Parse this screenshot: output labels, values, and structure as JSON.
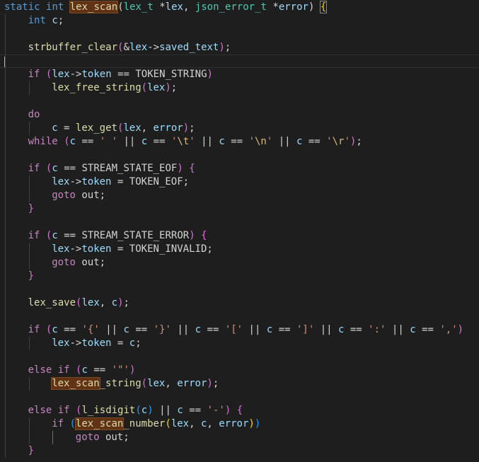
{
  "editor": {
    "language": "c",
    "highlighted_symbol": "lex_scan",
    "colors": {
      "background": "#1e1e1e",
      "keyword": "#569cd6",
      "control": "#c586c0",
      "type": "#4ec9b0",
      "function": "#dcdcaa",
      "variable": "#9cdcfe",
      "string": "#ce9178",
      "escape": "#d7ba7d",
      "selection_highlight": "#613214"
    },
    "lines": [
      {
        "indent": 0,
        "tokens": [
          [
            "kw",
            "static"
          ],
          [
            "op",
            " "
          ],
          [
            "kw",
            "int"
          ],
          [
            "op",
            " "
          ],
          [
            "fn hl",
            "lex_scan"
          ],
          [
            "op",
            "("
          ],
          [
            "ty",
            "lex_t"
          ],
          [
            "op",
            " *"
          ],
          [
            "var",
            "lex"
          ],
          [
            "op",
            ", "
          ],
          [
            "ty",
            "json_error_t"
          ],
          [
            "op",
            " *"
          ],
          [
            "var",
            "error"
          ],
          [
            "op",
            ") "
          ],
          [
            "br1 bm",
            "{"
          ]
        ]
      },
      {
        "indent": 1,
        "tokens": [
          [
            "kw",
            "int"
          ],
          [
            "op",
            " "
          ],
          [
            "var",
            "c"
          ],
          [
            "op",
            ";"
          ]
        ]
      },
      {
        "indent": 0,
        "tokens": []
      },
      {
        "indent": 1,
        "tokens": [
          [
            "fn",
            "strbuffer_clear"
          ],
          [
            "br2",
            "("
          ],
          [
            "op",
            "&"
          ],
          [
            "var",
            "lex"
          ],
          [
            "op",
            "->"
          ],
          [
            "var",
            "saved_text"
          ],
          [
            "br2",
            ")"
          ],
          [
            "op",
            ";"
          ]
        ]
      },
      {
        "indent": 0,
        "tokens": [],
        "current": true
      },
      {
        "indent": 1,
        "tokens": [
          [
            "ctl",
            "if"
          ],
          [
            "op",
            " "
          ],
          [
            "br2",
            "("
          ],
          [
            "var",
            "lex"
          ],
          [
            "op",
            "->"
          ],
          [
            "var",
            "token"
          ],
          [
            "op",
            " == "
          ],
          [
            "op",
            "TOKEN_STRING"
          ],
          [
            "br2",
            ")"
          ]
        ]
      },
      {
        "indent": 2,
        "tokens": [
          [
            "fn",
            "lex_free_string"
          ],
          [
            "br2",
            "("
          ],
          [
            "var",
            "lex"
          ],
          [
            "br2",
            ")"
          ],
          [
            "op",
            ";"
          ]
        ]
      },
      {
        "indent": 0,
        "tokens": []
      },
      {
        "indent": 1,
        "tokens": [
          [
            "ctl",
            "do"
          ]
        ]
      },
      {
        "indent": 2,
        "tokens": [
          [
            "var",
            "c"
          ],
          [
            "op",
            " = "
          ],
          [
            "fn",
            "lex_get"
          ],
          [
            "br2",
            "("
          ],
          [
            "var",
            "lex"
          ],
          [
            "op",
            ", "
          ],
          [
            "var",
            "error"
          ],
          [
            "br2",
            ")"
          ],
          [
            "op",
            ";"
          ]
        ]
      },
      {
        "indent": 1,
        "tokens": [
          [
            "ctl",
            "while"
          ],
          [
            "op",
            " "
          ],
          [
            "br2",
            "("
          ],
          [
            "var",
            "c"
          ],
          [
            "op",
            " == "
          ],
          [
            "str",
            "' '"
          ],
          [
            "op",
            " || "
          ],
          [
            "var",
            "c"
          ],
          [
            "op",
            " == "
          ],
          [
            "str",
            "'"
          ],
          [
            "esc",
            "\\t"
          ],
          [
            "str",
            "'"
          ],
          [
            "op",
            " || "
          ],
          [
            "var",
            "c"
          ],
          [
            "op",
            " == "
          ],
          [
            "str",
            "'"
          ],
          [
            "esc",
            "\\n"
          ],
          [
            "str",
            "'"
          ],
          [
            "op",
            " || "
          ],
          [
            "var",
            "c"
          ],
          [
            "op",
            " == "
          ],
          [
            "str",
            "'"
          ],
          [
            "esc",
            "\\r"
          ],
          [
            "str",
            "'"
          ],
          [
            "br2",
            ")"
          ],
          [
            "op",
            ";"
          ]
        ]
      },
      {
        "indent": 0,
        "tokens": []
      },
      {
        "indent": 1,
        "tokens": [
          [
            "ctl",
            "if"
          ],
          [
            "op",
            " "
          ],
          [
            "br2",
            "("
          ],
          [
            "var",
            "c"
          ],
          [
            "op",
            " == "
          ],
          [
            "op",
            "STREAM_STATE_EOF"
          ],
          [
            "br2",
            ")"
          ],
          [
            "op",
            " "
          ],
          [
            "br2",
            "{"
          ]
        ]
      },
      {
        "indent": 2,
        "tokens": [
          [
            "var",
            "lex"
          ],
          [
            "op",
            "->"
          ],
          [
            "var",
            "token"
          ],
          [
            "op",
            " = "
          ],
          [
            "op",
            "TOKEN_EOF"
          ],
          [
            "op",
            ";"
          ]
        ]
      },
      {
        "indent": 2,
        "tokens": [
          [
            "ctl",
            "goto"
          ],
          [
            "op",
            " out;"
          ]
        ]
      },
      {
        "indent": 1,
        "tokens": [
          [
            "br2",
            "}"
          ]
        ]
      },
      {
        "indent": 0,
        "tokens": []
      },
      {
        "indent": 1,
        "tokens": [
          [
            "ctl",
            "if"
          ],
          [
            "op",
            " "
          ],
          [
            "br2",
            "("
          ],
          [
            "var",
            "c"
          ],
          [
            "op",
            " == "
          ],
          [
            "op",
            "STREAM_STATE_ERROR"
          ],
          [
            "br2",
            ")"
          ],
          [
            "op",
            " "
          ],
          [
            "br2",
            "{"
          ]
        ]
      },
      {
        "indent": 2,
        "tokens": [
          [
            "var",
            "lex"
          ],
          [
            "op",
            "->"
          ],
          [
            "var",
            "token"
          ],
          [
            "op",
            " = "
          ],
          [
            "op",
            "TOKEN_INVALID"
          ],
          [
            "op",
            ";"
          ]
        ]
      },
      {
        "indent": 2,
        "tokens": [
          [
            "ctl",
            "goto"
          ],
          [
            "op",
            " out;"
          ]
        ]
      },
      {
        "indent": 1,
        "tokens": [
          [
            "br2",
            "}"
          ]
        ]
      },
      {
        "indent": 0,
        "tokens": []
      },
      {
        "indent": 1,
        "tokens": [
          [
            "fn",
            "lex_save"
          ],
          [
            "br2",
            "("
          ],
          [
            "var",
            "lex"
          ],
          [
            "op",
            ", "
          ],
          [
            "var",
            "c"
          ],
          [
            "br2",
            ")"
          ],
          [
            "op",
            ";"
          ]
        ]
      },
      {
        "indent": 0,
        "tokens": []
      },
      {
        "indent": 1,
        "tokens": [
          [
            "ctl",
            "if"
          ],
          [
            "op",
            " "
          ],
          [
            "br2",
            "("
          ],
          [
            "var",
            "c"
          ],
          [
            "op",
            " == "
          ],
          [
            "str",
            "'{'"
          ],
          [
            "op",
            " || "
          ],
          [
            "var",
            "c"
          ],
          [
            "op",
            " == "
          ],
          [
            "str",
            "'}'"
          ],
          [
            "op",
            " || "
          ],
          [
            "var",
            "c"
          ],
          [
            "op",
            " == "
          ],
          [
            "str",
            "'['"
          ],
          [
            "op",
            " || "
          ],
          [
            "var",
            "c"
          ],
          [
            "op",
            " == "
          ],
          [
            "str",
            "']'"
          ],
          [
            "op",
            " || "
          ],
          [
            "var",
            "c"
          ],
          [
            "op",
            " == "
          ],
          [
            "str",
            "':'"
          ],
          [
            "op",
            " || "
          ],
          [
            "var",
            "c"
          ],
          [
            "op",
            " == "
          ],
          [
            "str",
            "','"
          ],
          [
            "br2",
            ")"
          ]
        ]
      },
      {
        "indent": 2,
        "tokens": [
          [
            "var",
            "lex"
          ],
          [
            "op",
            "->"
          ],
          [
            "var",
            "token"
          ],
          [
            "op",
            " = "
          ],
          [
            "var",
            "c"
          ],
          [
            "op",
            ";"
          ]
        ]
      },
      {
        "indent": 0,
        "tokens": []
      },
      {
        "indent": 1,
        "tokens": [
          [
            "ctl",
            "else"
          ],
          [
            "op",
            " "
          ],
          [
            "ctl",
            "if"
          ],
          [
            "op",
            " "
          ],
          [
            "br2",
            "("
          ],
          [
            "var",
            "c"
          ],
          [
            "op",
            " == "
          ],
          [
            "str",
            "'\"'"
          ],
          [
            "br2",
            ")"
          ]
        ]
      },
      {
        "indent": 2,
        "tokens": [
          [
            "fn hl",
            "lex_scan"
          ],
          [
            "fn",
            "_string"
          ],
          [
            "br2",
            "("
          ],
          [
            "var",
            "lex"
          ],
          [
            "op",
            ", "
          ],
          [
            "var",
            "error"
          ],
          [
            "br2",
            ")"
          ],
          [
            "op",
            ";"
          ]
        ]
      },
      {
        "indent": 0,
        "tokens": []
      },
      {
        "indent": 1,
        "tokens": [
          [
            "ctl",
            "else"
          ],
          [
            "op",
            " "
          ],
          [
            "ctl",
            "if"
          ],
          [
            "op",
            " "
          ],
          [
            "br2",
            "("
          ],
          [
            "fn",
            "l_isdigit"
          ],
          [
            "br3",
            "("
          ],
          [
            "var",
            "c"
          ],
          [
            "br3",
            ")"
          ],
          [
            "op",
            " || "
          ],
          [
            "var",
            "c"
          ],
          [
            "op",
            " == "
          ],
          [
            "str",
            "'-'"
          ],
          [
            "br2",
            ")"
          ],
          [
            "op",
            " "
          ],
          [
            "br2",
            "{"
          ]
        ]
      },
      {
        "indent": 2,
        "tokens": [
          [
            "ctl",
            "if"
          ],
          [
            "op",
            " "
          ],
          [
            "br3",
            "("
          ],
          [
            "fn hl",
            "lex_scan"
          ],
          [
            "fn",
            "_number"
          ],
          [
            "br1",
            "("
          ],
          [
            "var",
            "lex"
          ],
          [
            "op",
            ", "
          ],
          [
            "var",
            "c"
          ],
          [
            "op",
            ", "
          ],
          [
            "var",
            "error"
          ],
          [
            "br1",
            ")"
          ],
          [
            "br3",
            ")"
          ]
        ]
      },
      {
        "indent": 3,
        "tokens": [
          [
            "ctl",
            "goto"
          ],
          [
            "op",
            " out;"
          ]
        ]
      },
      {
        "indent": 1,
        "tokens": [
          [
            "br2",
            "}"
          ]
        ]
      }
    ]
  }
}
